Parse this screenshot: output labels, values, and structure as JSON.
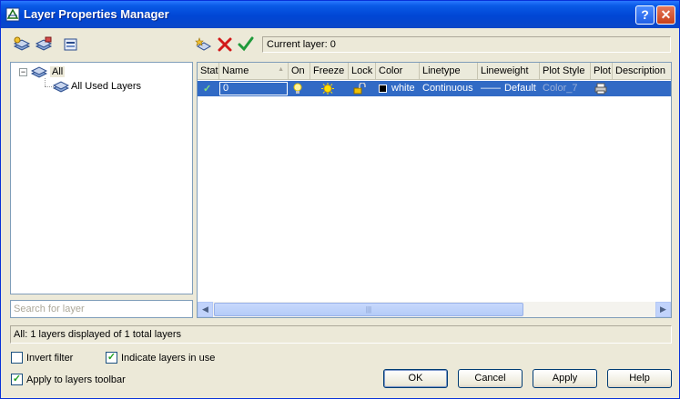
{
  "window": {
    "title": "Layer Properties Manager",
    "help_label": "?",
    "close_label": "✕",
    "accent": "#0046d5"
  },
  "toolbar": {
    "new_property_filter": "layers-filter-icon",
    "new_group_filter": "group-filter-icon",
    "layer_states": "layer-states-icon",
    "new_layer": "new-layer-icon",
    "delete_layer": "delete-icon",
    "set_current": "checkmark-icon"
  },
  "current_layer": {
    "text": "Current layer: 0"
  },
  "tree": {
    "root": {
      "expander": "−",
      "label": "All"
    },
    "child": {
      "label": "All Used Layers"
    }
  },
  "search": {
    "placeholder": "Search for layer"
  },
  "columns": [
    "Stat",
    "Name",
    "On",
    "Freeze",
    "Lock",
    "Color",
    "Linetype",
    "Lineweight",
    "Plot Style",
    "Plot",
    "Description"
  ],
  "sort_indicator": "▲",
  "layers": [
    {
      "status": "✓",
      "name": "0",
      "on": "lightbulb-icon",
      "freeze": "sun-icon",
      "lock": "unlock-icon",
      "color_name": "white",
      "color_swatch": "#000000",
      "linetype": "Continuous",
      "lineweight_line": "——",
      "lineweight": "Default",
      "plot_style": "Color_7",
      "plot": "printer-icon",
      "description": ""
    }
  ],
  "scrollbar": {
    "left": "◀",
    "right": "▶",
    "grip": "|||"
  },
  "status": {
    "text": "All: 1 layers displayed of 1 total layers"
  },
  "options": {
    "invert_filter": {
      "label": "Invert filter",
      "checked": false
    },
    "indicate_in_use": {
      "label": "Indicate layers in use",
      "checked": true,
      "mark": "✓"
    },
    "apply_to_toolbar": {
      "label": "Apply to layers toolbar",
      "checked": true,
      "mark": "✓"
    }
  },
  "buttons": {
    "ok": "OK",
    "cancel": "Cancel",
    "apply": "Apply",
    "help": "Help"
  }
}
